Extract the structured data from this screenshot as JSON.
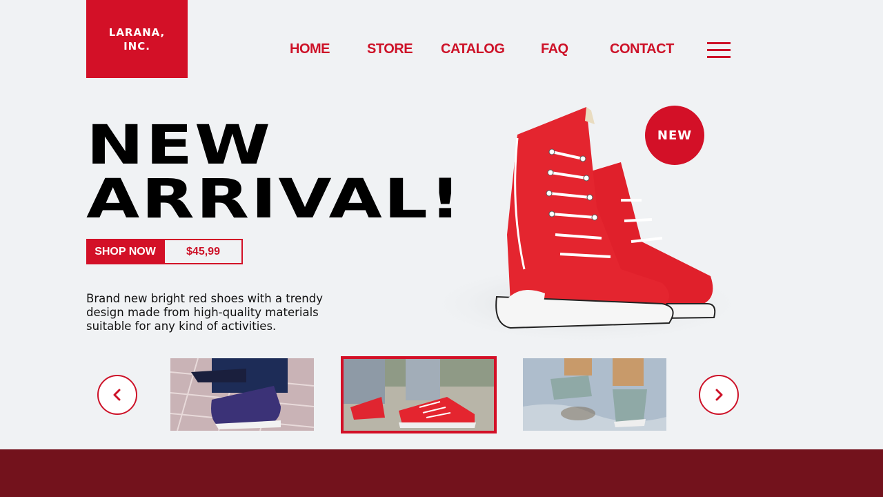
{
  "brand": {
    "line1": "LARANA,",
    "line2": "INC."
  },
  "nav": {
    "items": [
      "HOME",
      "STORE",
      "CATALOG",
      "FAQ",
      "CONTACT"
    ],
    "menu_icon": "hamburger-menu-icon"
  },
  "hero": {
    "headline_line1": "NEW",
    "headline_line2": "ARRIVAL!",
    "cta_label": "SHOP NOW",
    "price": "$45,99",
    "description": "Brand new bright red shoes with a trendy design made from high-quality materials suitable for any kind of activities.",
    "badge": "NEW",
    "image": "red-high-top-sneakers"
  },
  "carousel": {
    "prev_icon": "chevron-left-icon",
    "next_icon": "chevron-right-icon",
    "thumbnails": [
      {
        "image": "navy-suede-sneakers-on-pavement",
        "active": false
      },
      {
        "image": "red-sneakers-on-street",
        "active": true
      },
      {
        "image": "grey-sneakers-splashing-puddle",
        "active": false
      }
    ]
  },
  "colors": {
    "accent": "#d31027",
    "nav_text": "#cd1228",
    "background": "#f0f2f4",
    "footer": "#73121c"
  }
}
